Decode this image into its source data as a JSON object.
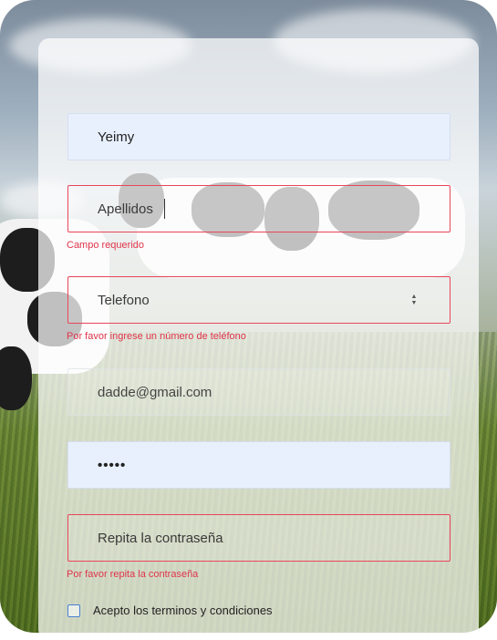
{
  "form": {
    "first_name": {
      "value": "Yeimy"
    },
    "last_name": {
      "placeholder": "Apellidos",
      "error": "Campo requerido"
    },
    "phone": {
      "placeholder": "Telefono",
      "error": "Por favor ingrese un número de teléfono"
    },
    "email": {
      "value": "dadde@gmail.com"
    },
    "password": {
      "value": "•••••"
    },
    "repeat_password": {
      "placeholder": "Repita la contraseña",
      "error": "Por favor repita la contraseña"
    },
    "terms": {
      "label": "Acepto los terminos y condiciones",
      "checked": false
    }
  },
  "colors": {
    "error": "#e0344a",
    "autofill_bg": "#e8f0fe",
    "checkbox_border": "#4a7fd0"
  }
}
